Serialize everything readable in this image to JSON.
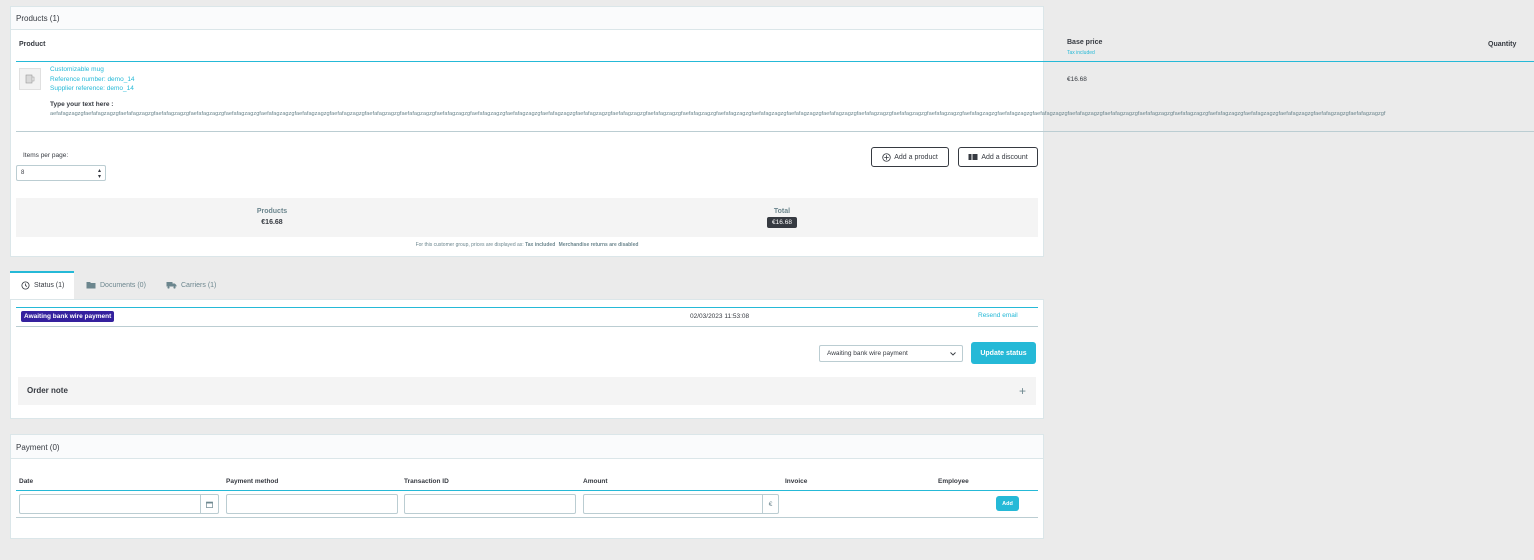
{
  "products_card": {
    "title": "Products (1)",
    "columns": {
      "product": "Product",
      "base_price": "Base price",
      "tax_included": "Tax included",
      "quantity": "Quantity"
    },
    "product": {
      "name": "Customizable mug",
      "reference": "Reference number: demo_14",
      "supplier_reference": "Supplier reference: demo_14",
      "custom_label": "Type your text here :",
      "custom_text": "aefafagzagzgfaefafagzagzgfaefafagzagzgfaefafagzagzgfaefafagzagzgfaefafagzagzgfaefafagzagzgfaefafagzagzgfaefafagzagzgfaefafagzagzgfaefafagzagzgfaefafagzagzgfaefafagzagzgfaefafagzagzgfaefafagzagzgfaefafagzagzgfaefafagzagzgfaefafagzagzgfaefafagzagzgfaefafagzagzgfaefafagzagzgfaefafagzagzgfaefafagzagzgfaefafagzagzgfaefafagzagzgfaefafagzagzgfaefafagzagzgfaefafagzagzgfaefafagzagzgfaefafagzagzgfaefafagzagzgfaefafagzagzgfaefafagzagzgfaefafagzagzgfaefafagzagzgfaefafagzagzgfaefafagzagzgfaefafagzagzgf",
      "base_price": "€16.68"
    },
    "items_per_page_label": "Items per page:",
    "items_per_page_value": "8",
    "add_product_label": "Add a product",
    "add_discount_label": "Add a discount",
    "summary": {
      "products_label": "Products",
      "products_value": "€16.68",
      "total_label": "Total",
      "total_value": "€16.68"
    },
    "footnote_prefix": "For this customer group, prices are displayed as:",
    "footnote_tax": "Tax included",
    "footnote_returns": "Merchandise returns are disabled"
  },
  "tabs": [
    {
      "label": "Status (1)",
      "icon": "history-icon",
      "active": true
    },
    {
      "label": "Documents (0)",
      "icon": "folder-icon",
      "active": false
    },
    {
      "label": "Carriers (1)",
      "icon": "truck-icon",
      "active": false
    }
  ],
  "status_panel": {
    "status_badge": "Awaiting bank wire payment",
    "status_badge_color": "#34219e",
    "date": "02/03/2023 11:53:08",
    "resend_email": "Resend email",
    "select_value": "Awaiting bank wire payment",
    "update_status_label": "Update status",
    "order_note_title": "Order note",
    "order_note_toggle": "+"
  },
  "payment_card": {
    "title": "Payment (0)",
    "columns": [
      "Date",
      "Payment method",
      "Transaction ID",
      "Amount",
      "Invoice",
      "Employee"
    ],
    "currency_symbol": "€",
    "add_label": "Add"
  },
  "colors": {
    "accent": "#25b9d7",
    "dark": "#363a41",
    "muted": "#6c868e"
  }
}
